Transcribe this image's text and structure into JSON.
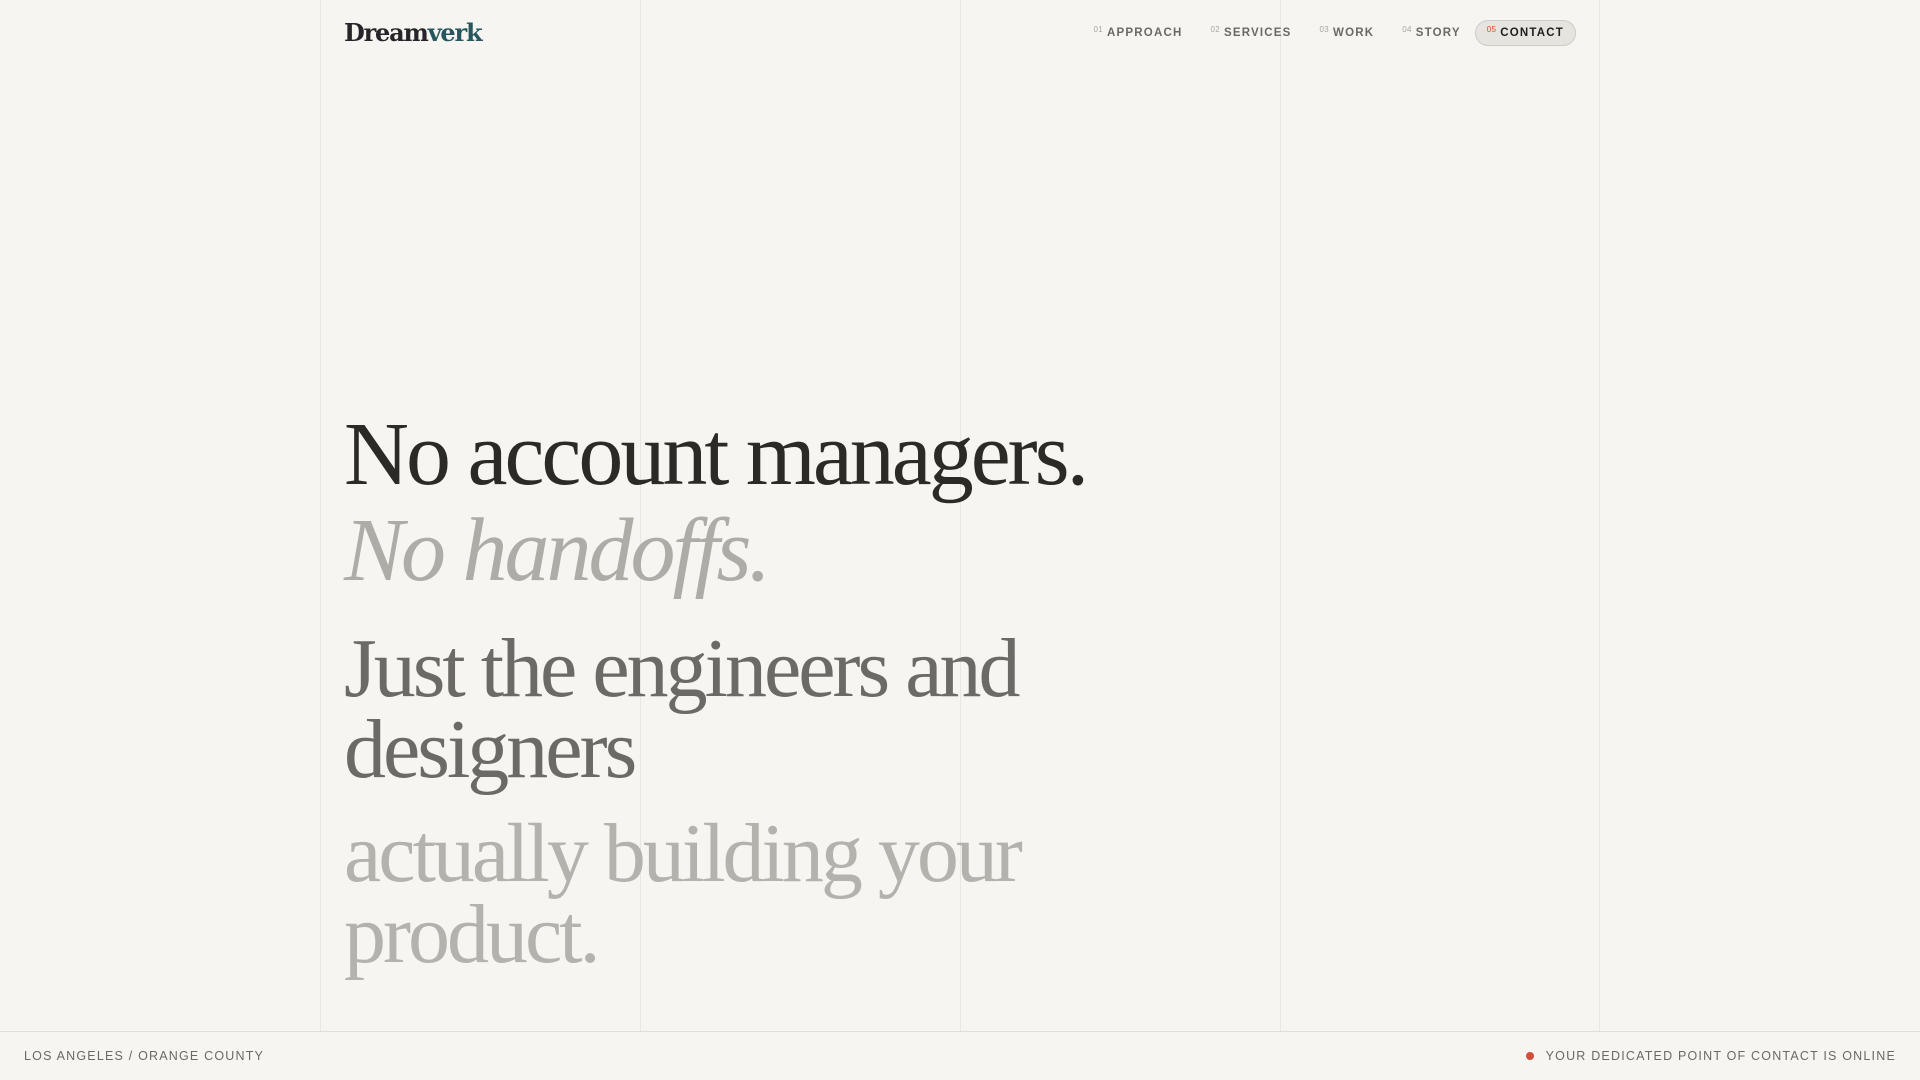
{
  "brand": {
    "logo_main": "Dream",
    "logo_accent": "verk"
  },
  "nav": {
    "items": [
      {
        "num": "01",
        "label": "APPROACH"
      },
      {
        "num": "02",
        "label": "SERVICES"
      },
      {
        "num": "03",
        "label": "WORK"
      },
      {
        "num": "04",
        "label": "STORY"
      },
      {
        "num": "05",
        "label": "CONTACT",
        "active": true
      }
    ]
  },
  "hero": {
    "line1": "No account managers.",
    "line2": "No handoffs.",
    "line3": "Just the engineers and designers",
    "line4": "actually building your product."
  },
  "footer": {
    "location": "LOS ANGELES / ORANGE COUNTY",
    "status": "YOUR DEDICATED POINT OF CONTACT IS ONLINE"
  },
  "colors": {
    "background": "#f6f5f1",
    "accent": "#d04e3a",
    "brand_accent": "#27565e"
  },
  "icons": {
    "status": "status-dot-icon"
  }
}
